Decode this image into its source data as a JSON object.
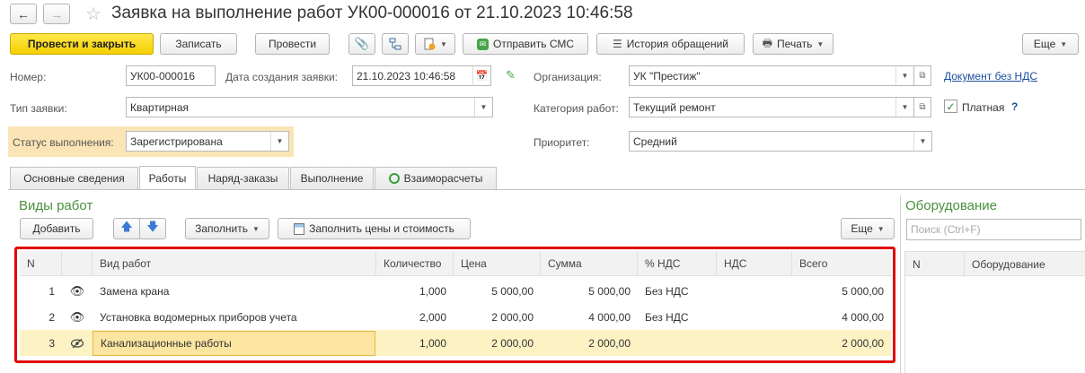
{
  "window": {
    "title": "Заявка на выполнение работ УК00-000016 от 21.10.2023 10:46:58"
  },
  "toolbar": {
    "post_close": "Провести и закрыть",
    "save": "Записать",
    "post": "Провести",
    "send_sms": "Отправить СМС",
    "history": "История обращений",
    "print": "Печать",
    "more": "Еще"
  },
  "form": {
    "number_label": "Номер:",
    "number_value": "УК00-000016",
    "created_label": "Дата создания заявки:",
    "created_value": "21.10.2023 10:46:58",
    "org_label": "Организация:",
    "org_value": "УК \"Престиж\"",
    "no_vat_link": "Документ без НДС",
    "type_label": "Тип заявки:",
    "type_value": "Квартирная",
    "category_label": "Категория работ:",
    "category_value": "Текущий ремонт",
    "paid_label": "Платная",
    "paid_help": "?",
    "status_label": "Статус выполнения:",
    "status_value": "Зарегистрирована",
    "priority_label": "Приоритет:",
    "priority_value": "Средний"
  },
  "tabs": [
    {
      "label": "Основные сведения"
    },
    {
      "label": "Работы"
    },
    {
      "label": "Наряд-заказы"
    },
    {
      "label": "Выполнение"
    },
    {
      "label": "Взаиморасчеты"
    }
  ],
  "works": {
    "title": "Виды работ",
    "add": "Добавить",
    "fill": "Заполнить",
    "fill_prices": "Заполнить цены и стоимость",
    "more": "Еще",
    "columns": [
      "N",
      "Вид работ",
      "Количество",
      "Цена",
      "Сумма",
      "% НДС",
      "НДС",
      "Всего"
    ],
    "rows": [
      {
        "n": "1",
        "name": "Замена крана",
        "qty": "1,000",
        "price": "5 000,00",
        "sum": "5 000,00",
        "vat_rate": "Без НДС",
        "vat": "",
        "total": "5 000,00"
      },
      {
        "n": "2",
        "name": "Установка водомерных приборов учета",
        "qty": "2,000",
        "price": "2 000,00",
        "sum": "4 000,00",
        "vat_rate": "Без НДС",
        "vat": "",
        "total": "4 000,00"
      },
      {
        "n": "3",
        "name": "Канализационные работы",
        "qty": "1,000",
        "price": "2 000,00",
        "sum": "2 000,00",
        "vat_rate": "",
        "vat": "",
        "total": "2 000,00"
      }
    ]
  },
  "equipment": {
    "title": "Оборудование",
    "search_placeholder": "Поиск (Ctrl+F)",
    "columns": [
      "N",
      "Оборудование"
    ]
  },
  "colors": {
    "accent_green": "#4a8f3c",
    "highlight_red": "#e00000",
    "selected_row": "#fdf2c4",
    "primary_button": "#f5cf00"
  }
}
